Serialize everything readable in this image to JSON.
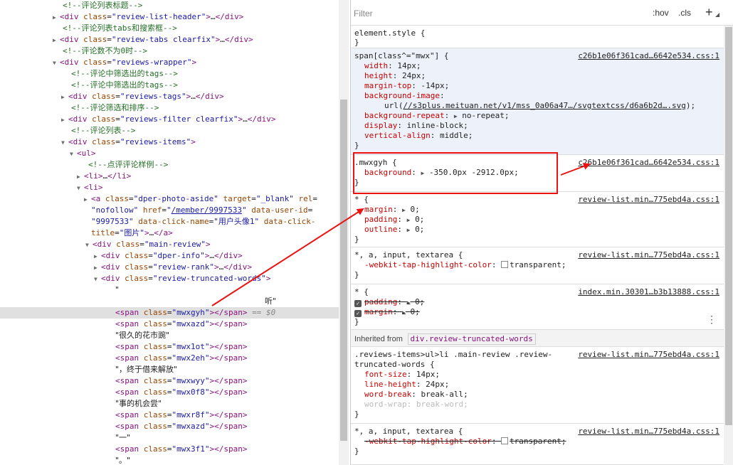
{
  "dom_tree": {
    "lines": [
      {
        "type": "comment",
        "text": "<!--评论列表标题-->"
      },
      {
        "type": "node",
        "tag": "div",
        "attrs": [
          [
            "class",
            "review-list-header"
          ]
        ],
        "collapsed": true
      },
      {
        "type": "comment",
        "text": "<!--评论列表tabs和搜索框-->"
      },
      {
        "type": "node",
        "tag": "div",
        "attrs": [
          [
            "class",
            "review-tabs clearfix"
          ]
        ],
        "collapsed": true
      },
      {
        "type": "comment",
        "text": "<!--评论数不为0时-->"
      },
      {
        "type": "open",
        "tag": "div",
        "attrs": [
          [
            "class",
            "reviews-wrapper"
          ]
        ]
      },
      {
        "type": "comment",
        "text": "<!--评论中筛选出的tags-->"
      },
      {
        "type": "comment",
        "text": "<!--评论中筛选出的tags-->"
      },
      {
        "type": "node",
        "tag": "div",
        "attrs": [
          [
            "class",
            "reviews-tags"
          ]
        ],
        "collapsed": true
      },
      {
        "type": "comment",
        "text": "<!--评论筛选和排序-->"
      },
      {
        "type": "node",
        "tag": "div",
        "attrs": [
          [
            "class",
            "reviews-filter clearfix"
          ]
        ],
        "collapsed": true
      },
      {
        "type": "comment",
        "text": "<!--评论列表-->"
      },
      {
        "type": "open",
        "tag": "div",
        "attrs": [
          [
            "class",
            "reviews-items"
          ]
        ]
      },
      {
        "type": "open",
        "tag": "ul",
        "attrs": []
      },
      {
        "type": "comment",
        "text": "<!--点评评论样例-->"
      },
      {
        "type": "node",
        "tag": "li",
        "attrs": [],
        "collapsed": true
      },
      {
        "type": "open",
        "tag": "li",
        "attrs": []
      },
      {
        "type": "raw",
        "text": "<a class=\"dper-photo-aside\" target=\"_blank\" rel="
      },
      {
        "type": "raw",
        "text": "\"nofollow\" href=\"/member/9997533\" data-user-id="
      },
      {
        "type": "raw",
        "text": "\"9997533\" data-click-name=\"用户头像1\" data-click-"
      },
      {
        "type": "raw",
        "text": "title=\"图片\">…</a>"
      },
      {
        "type": "open",
        "tag": "div",
        "attrs": [
          [
            "class",
            "main-review"
          ]
        ]
      },
      {
        "type": "node",
        "tag": "div",
        "attrs": [
          [
            "class",
            "dper-info"
          ]
        ],
        "collapsed": true
      },
      {
        "type": "node",
        "tag": "div",
        "attrs": [
          [
            "class",
            "review-rank"
          ]
        ],
        "collapsed": true
      },
      {
        "type": "open",
        "tag": "div",
        "attrs": [
          [
            "class",
            "review-truncated-words"
          ]
        ]
      },
      {
        "type": "text",
        "text": "\""
      },
      {
        "type": "text",
        "text": "听\""
      },
      {
        "type": "span",
        "cls": "mwxgyh",
        "selected": true
      },
      {
        "type": "span",
        "cls": "mwxazd"
      },
      {
        "type": "text",
        "text": "\"很久的花市豌\""
      },
      {
        "type": "span",
        "cls": "mwx1ot"
      },
      {
        "type": "span",
        "cls": "mwx2eh"
      },
      {
        "type": "text",
        "text": "\"，终于借来解放\""
      },
      {
        "type": "span",
        "cls": "mwxwyy"
      },
      {
        "type": "span",
        "cls": "mwx0f8"
      },
      {
        "type": "text",
        "text": "\"事的机会尝\""
      },
      {
        "type": "span",
        "cls": "mwxr8f"
      },
      {
        "type": "span",
        "cls": "mwxazd"
      },
      {
        "type": "text",
        "text": "\"一\""
      },
      {
        "type": "span",
        "cls": "mwx3f1"
      },
      {
        "type": "text",
        "text": "\"。\""
      }
    ],
    "selected_suffix": " == $0",
    "ellipsis": "..."
  },
  "styles": {
    "filter_placeholder": "Filter",
    "hov_label": ":hov",
    "cls_label": ".cls",
    "add_label": "+",
    "element_style_selector": "element.style {",
    "close_brace": "}",
    "rules": [
      {
        "selector": "span[class^=\"mwx\"] {",
        "source": "c26b1e06f361cad…6642e534.css:1",
        "decls": [
          {
            "p": "width",
            "v": "14px;"
          },
          {
            "p": "height",
            "v": "24px;"
          },
          {
            "p": "margin-top",
            "v": "-14px;"
          },
          {
            "p": "background-image",
            "v": ""
          },
          {
            "p": "",
            "v": "url(",
            "url": "//s3plus.meituan.net/v1/mss_0a06a47…/svgtextcss/d6a6b2d….svg",
            "after": ");"
          },
          {
            "p": "background-repeat",
            "v": "no-repeat;",
            "tri": true
          },
          {
            "p": "display",
            "v": "inline-block;"
          },
          {
            "p": "vertical-align",
            "v": "middle;"
          }
        ]
      },
      {
        "selector": ".mwxgyh {",
        "source": "c26b1e06f361cad…6642e534.css:1",
        "decls": [
          {
            "p": "background",
            "v": "-350.0px -2912.0px;",
            "tri": true
          }
        ]
      },
      {
        "selector": "* {",
        "source": "review-list.min…775ebd4a.css:1",
        "decls": [
          {
            "p": "margin",
            "v": "0;",
            "tri": true
          },
          {
            "p": "padding",
            "v": "0;",
            "tri": true
          },
          {
            "p": "outline",
            "v": "0;",
            "tri": true
          }
        ]
      },
      {
        "selector": "*, a, input, textarea {",
        "source": "review-list.min…775ebd4a.css:1",
        "decls": [
          {
            "p": "-webkit-tap-highlight-color",
            "v": "transparent;",
            "swatch": true
          }
        ]
      },
      {
        "selector": "* {",
        "source": "index.min.30301…b3b13888.css:1",
        "decls": [
          {
            "p": "padding",
            "v": "0;",
            "tri": true,
            "struck": true,
            "check": true
          },
          {
            "p": "margin",
            "v": "0;",
            "tri": true,
            "struck": true,
            "check": true
          }
        ]
      }
    ],
    "inherited_label": "Inherited from",
    "inherited_from": "div.review-truncated-words",
    "inherited_rules": [
      {
        "selector1": ".reviews-items>ul>li .main-review .review-",
        "selector2": "truncated-words {",
        "source": "review-list.min…775ebd4a.css:1",
        "decls": [
          {
            "p": "font-size",
            "v": "14px;"
          },
          {
            "p": "line-height",
            "v": "24px;"
          },
          {
            "p": "word-break",
            "v": "break-all;"
          },
          {
            "p": "word-wrap",
            "v": "break-word;",
            "muted": true
          }
        ]
      },
      {
        "selector": "*, a, input, textarea {",
        "source": "review-list.min…775ebd4a.css:1",
        "decls": [
          {
            "p": "-webkit-tap-highlight-color",
            "v": "transparent;",
            "swatch": true,
            "struck": true
          }
        ]
      }
    ],
    "menu_dots": "⋮"
  },
  "colors": {
    "tag": "#881280",
    "attr": "#994500",
    "value": "#1a1aa6",
    "comment": "#236e25",
    "annotation": "#ee1111"
  }
}
